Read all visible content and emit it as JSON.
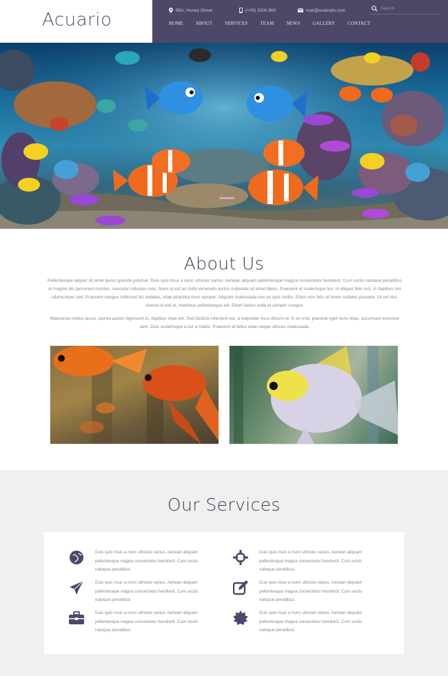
{
  "brand": {
    "logo": "Acuario"
  },
  "topbar": {
    "address": "95A, Honey Street",
    "phone": "(+00) 2000 860",
    "email": "mail@example.com",
    "search_placeholder": "Search"
  },
  "nav": {
    "items": [
      "Home",
      "About",
      "Services",
      "Team",
      "News",
      "Gallery",
      "Contact"
    ]
  },
  "hero": {
    "slide_indicator": "active"
  },
  "about": {
    "title": "About Us",
    "paragraph_1": "Pellentesque aliquet sit amet purus gravida pulvinar. Duis quis risus a nunc ultricies varius. Aenean aliquam pellentesque magna consectetur hendrerit. Cum sociis natoque penatibus et magnis dis parturient montes, nascetur ridiculus mus. Nunc id est ac nulla venenatis luctus vulputate sit amet libero. Praesent et scelerisque leo. In aliquet felis orci, in dapibus nisi ullamcorper sed. Praesent congue sollicitud dis sodales, vitae pharetra risus semper. Aliquam malesuada non ex quis mollis. Etiam non felis at lorem sodales posuere. Ut vel nisl, viverra id nisi et, maximus pellentesque elit. Etiam luctus nulla at semper congue.",
    "paragraph_2": "Maecenas metus purus, lacinia auctor dignissim in, dapibus vitae elit. Sed facilisis interdum est, a vulputate risus dictum ut. In ex erat, placerat eget nunc vitae, accumsan euismod sem. Duis scelerisque a dui a mattis. Praesent at tellus vitae neque ultrices malesuada."
  },
  "services": {
    "title": "Our Services",
    "items": [
      {
        "icon": "globe-icon",
        "text": "Duis quis risus a nunc ultricies varius. Aenean aliquam pellentesque magna consectetur hendrerit. Cum sociis natoque penatibus."
      },
      {
        "icon": "crosshair-icon",
        "text": "Duis quis risus a nunc ultricies varius. Aenean aliquam pellentesque magna consectetur hendrerit. Cum sociis natoque penatibus."
      },
      {
        "icon": "paper-plane-icon",
        "text": "Duis quis risus a nunc ultricies varius. Aenean aliquam pellentesque magna consectetur hendrerit. Cum sociis natoque penatibus."
      },
      {
        "icon": "edit-icon",
        "text": "Duis quis risus a nunc ultricies varius. Aenean aliquam pellentesque magna consectetur hendrerit. Cum sociis natoque penatibus."
      },
      {
        "icon": "briefcase-icon",
        "text": "Duis quis risus a nunc ultricies varius. Aenean aliquam pellentesque magna consectetur hendrerit. Cum sociis natoque penatibus."
      },
      {
        "icon": "certificate-icon",
        "text": "Duis quis risus a nunc ultricies varius. Aenean aliquam pellentesque magna consectetur hendrerit. Cum sociis natoque penatibus."
      }
    ]
  },
  "colors": {
    "topbar_bg": "#4c4868",
    "heading": "#3d3a4f",
    "icon": "#4c4868",
    "services_bg": "#f0f0f0",
    "slider_dot": "#e9a2b4"
  }
}
